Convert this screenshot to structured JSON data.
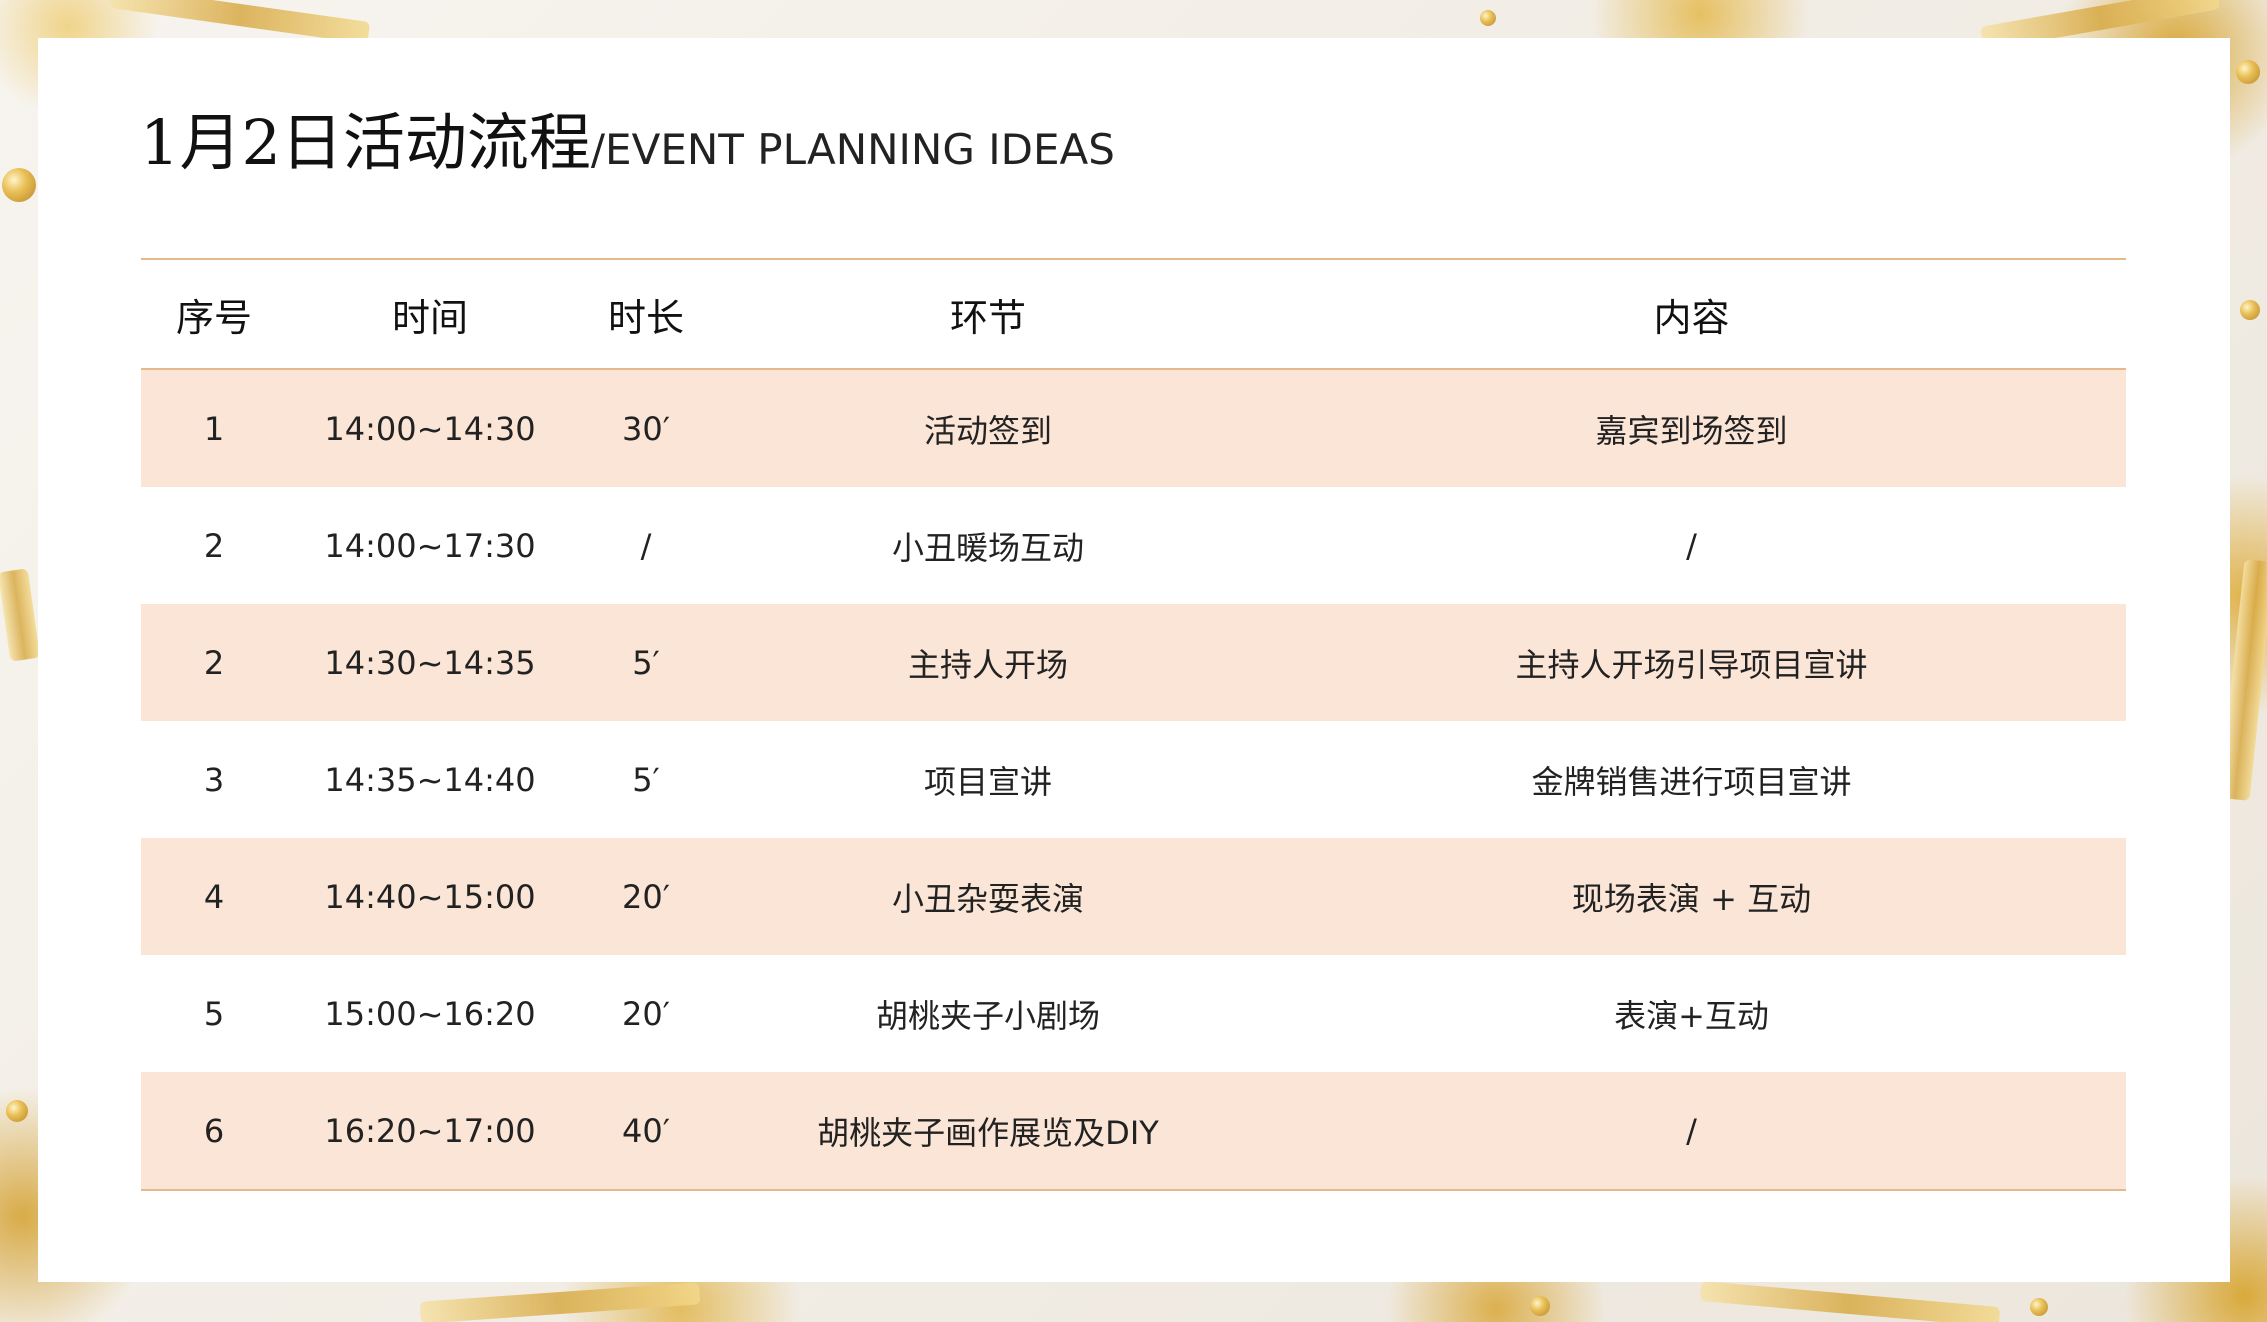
{
  "title": {
    "cn": "1月2日活动流程",
    "en": "/EVENT PLANNING IDEAS"
  },
  "table": {
    "headers": [
      "序号",
      "时间",
      "时长",
      "环节",
      "内容"
    ],
    "rows": [
      [
        "1",
        "14:00~14:30",
        "30′",
        "活动签到",
        "嘉宾到场签到"
      ],
      [
        "2",
        "14:00~17:30",
        "/",
        "小丑暖场互动",
        "/"
      ],
      [
        "2",
        "14:30~14:35",
        "5′",
        "主持人开场",
        "主持人开场引导项目宣讲"
      ],
      [
        "3",
        "14:35~14:40",
        "5′",
        "项目宣讲",
        "金牌销售进行项目宣讲"
      ],
      [
        "4",
        "14:40~15:00",
        "20′",
        "小丑杂耍表演",
        "现场表演 + 互动"
      ],
      [
        "5",
        "15:00~16:20",
        "20′",
        "胡桃夹子小剧场",
        "表演+互动"
      ],
      [
        "6",
        "16:20~17:00",
        "40′",
        "胡桃夹子画作展览及DIY",
        "/"
      ]
    ]
  },
  "colors": {
    "row_shade": "#fae5d7",
    "rule": "#e5b98a",
    "card": "#ffffff"
  }
}
